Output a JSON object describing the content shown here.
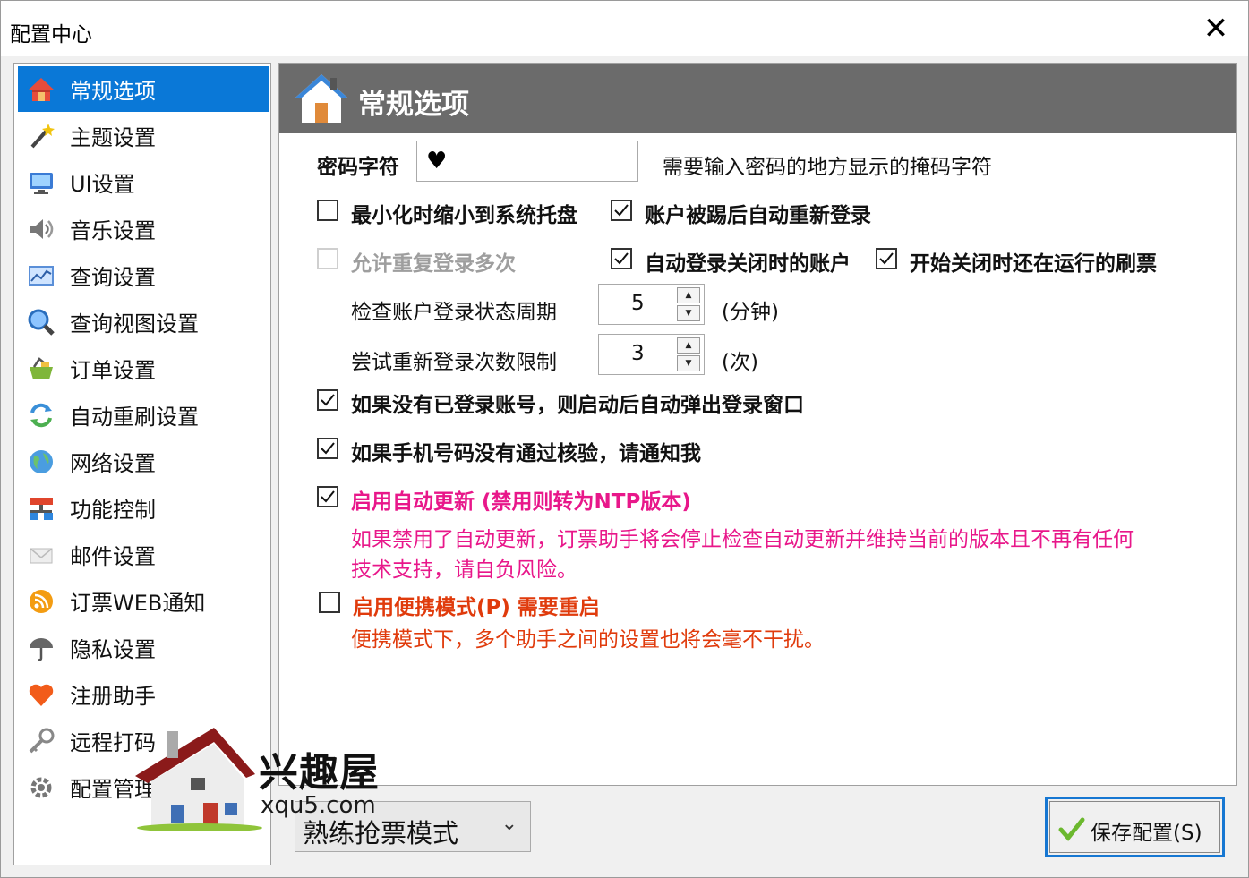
{
  "window": {
    "title": "配置中心",
    "close_glyph": "✕"
  },
  "sidebar": {
    "items": [
      {
        "label": "常规选项",
        "icon": "home-icon"
      },
      {
        "label": "主题设置",
        "icon": "magic-wand-icon"
      },
      {
        "label": "UI设置",
        "icon": "monitor-icon"
      },
      {
        "label": "音乐设置",
        "icon": "speaker-icon"
      },
      {
        "label": "查询设置",
        "icon": "chart-icon"
      },
      {
        "label": "查询视图设置",
        "icon": "magnifier-icon"
      },
      {
        "label": "订单设置",
        "icon": "cart-icon"
      },
      {
        "label": "自动重刷设置",
        "icon": "refresh-icon"
      },
      {
        "label": "网络设置",
        "icon": "globe-icon"
      },
      {
        "label": "功能控制",
        "icon": "network-icon"
      },
      {
        "label": "邮件设置",
        "icon": "envelope-icon"
      },
      {
        "label": "订票WEB通知",
        "icon": "rss-icon"
      },
      {
        "label": "隐私设置",
        "icon": "umbrella-icon"
      },
      {
        "label": "注册助手",
        "icon": "heart-icon"
      },
      {
        "label": "远程打码",
        "icon": "key-icon"
      },
      {
        "label": "配置管理",
        "icon": "gear-icon"
      }
    ]
  },
  "panel": {
    "title": "常规选项",
    "password_char": {
      "label": "密码字符",
      "value": "♥",
      "hint": "需要输入密码的地方显示的掩码字符"
    },
    "options": {
      "minimize_to_tray": {
        "label": "最小化时缩小到系统托盘",
        "checked": false
      },
      "relogin_on_kick": {
        "label": "账户被踢后自动重新登录",
        "checked": true
      },
      "allow_multi_login": {
        "label": "允许重复登录多次",
        "checked": false,
        "disabled": true
      },
      "autologin_closed": {
        "label": "自动登录关闭时的账户",
        "checked": true
      },
      "resume_refresh": {
        "label": "开始关闭时还在运行的刷票",
        "checked": true
      },
      "auto_popup_login": {
        "label": "如果没有已登录账号，则启动后自动弹出登录窗口",
        "checked": true
      },
      "notify_phone_verify": {
        "label": "如果手机号码没有通过核验，请通知我",
        "checked": true
      },
      "auto_update": {
        "label": "启用自动更新 (禁用则转为NTP版本)",
        "checked": true
      },
      "portable_mode": {
        "label": "启用便携模式(P)  需要重启",
        "checked": false
      }
    },
    "check_period": {
      "label": "检查账户登录状态周期",
      "value": "5",
      "unit": "(分钟)"
    },
    "retry_limit": {
      "label": "尝试重新登录次数限制",
      "value": "3",
      "unit": "(次)"
    },
    "auto_update_desc_1": "如果禁用了自动更新，订票助手将会停止检查自动更新并维持当前的版本且不再有任何",
    "auto_update_desc_2": "技术支持，请自负风险。",
    "portable_desc": "便携模式下，多个助手之间的设置也将会毫不干扰。"
  },
  "footer": {
    "mode": "熟练抢票模式",
    "save_label": "保存配置(S)"
  },
  "watermark": {
    "name": "兴趣屋",
    "url": "xqu5.com"
  }
}
